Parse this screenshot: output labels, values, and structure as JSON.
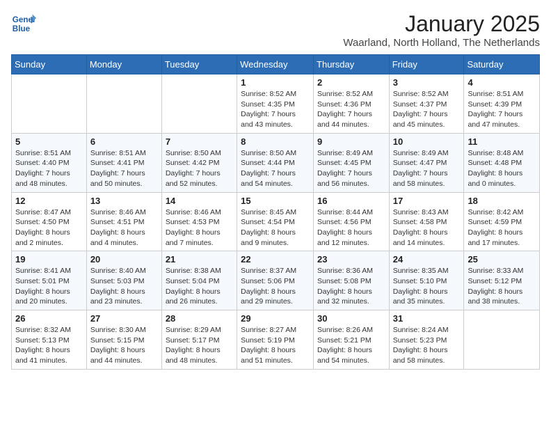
{
  "logo": {
    "line1": "General",
    "line2": "Blue"
  },
  "title": "January 2025",
  "subtitle": "Waarland, North Holland, The Netherlands",
  "weekdays": [
    "Sunday",
    "Monday",
    "Tuesday",
    "Wednesday",
    "Thursday",
    "Friday",
    "Saturday"
  ],
  "weeks": [
    [
      {
        "day": "",
        "info": ""
      },
      {
        "day": "",
        "info": ""
      },
      {
        "day": "",
        "info": ""
      },
      {
        "day": "1",
        "info": "Sunrise: 8:52 AM\nSunset: 4:35 PM\nDaylight: 7 hours\nand 43 minutes."
      },
      {
        "day": "2",
        "info": "Sunrise: 8:52 AM\nSunset: 4:36 PM\nDaylight: 7 hours\nand 44 minutes."
      },
      {
        "day": "3",
        "info": "Sunrise: 8:52 AM\nSunset: 4:37 PM\nDaylight: 7 hours\nand 45 minutes."
      },
      {
        "day": "4",
        "info": "Sunrise: 8:51 AM\nSunset: 4:39 PM\nDaylight: 7 hours\nand 47 minutes."
      }
    ],
    [
      {
        "day": "5",
        "info": "Sunrise: 8:51 AM\nSunset: 4:40 PM\nDaylight: 7 hours\nand 48 minutes."
      },
      {
        "day": "6",
        "info": "Sunrise: 8:51 AM\nSunset: 4:41 PM\nDaylight: 7 hours\nand 50 minutes."
      },
      {
        "day": "7",
        "info": "Sunrise: 8:50 AM\nSunset: 4:42 PM\nDaylight: 7 hours\nand 52 minutes."
      },
      {
        "day": "8",
        "info": "Sunrise: 8:50 AM\nSunset: 4:44 PM\nDaylight: 7 hours\nand 54 minutes."
      },
      {
        "day": "9",
        "info": "Sunrise: 8:49 AM\nSunset: 4:45 PM\nDaylight: 7 hours\nand 56 minutes."
      },
      {
        "day": "10",
        "info": "Sunrise: 8:49 AM\nSunset: 4:47 PM\nDaylight: 7 hours\nand 58 minutes."
      },
      {
        "day": "11",
        "info": "Sunrise: 8:48 AM\nSunset: 4:48 PM\nDaylight: 8 hours\nand 0 minutes."
      }
    ],
    [
      {
        "day": "12",
        "info": "Sunrise: 8:47 AM\nSunset: 4:50 PM\nDaylight: 8 hours\nand 2 minutes."
      },
      {
        "day": "13",
        "info": "Sunrise: 8:46 AM\nSunset: 4:51 PM\nDaylight: 8 hours\nand 4 minutes."
      },
      {
        "day": "14",
        "info": "Sunrise: 8:46 AM\nSunset: 4:53 PM\nDaylight: 8 hours\nand 7 minutes."
      },
      {
        "day": "15",
        "info": "Sunrise: 8:45 AM\nSunset: 4:54 PM\nDaylight: 8 hours\nand 9 minutes."
      },
      {
        "day": "16",
        "info": "Sunrise: 8:44 AM\nSunset: 4:56 PM\nDaylight: 8 hours\nand 12 minutes."
      },
      {
        "day": "17",
        "info": "Sunrise: 8:43 AM\nSunset: 4:58 PM\nDaylight: 8 hours\nand 14 minutes."
      },
      {
        "day": "18",
        "info": "Sunrise: 8:42 AM\nSunset: 4:59 PM\nDaylight: 8 hours\nand 17 minutes."
      }
    ],
    [
      {
        "day": "19",
        "info": "Sunrise: 8:41 AM\nSunset: 5:01 PM\nDaylight: 8 hours\nand 20 minutes."
      },
      {
        "day": "20",
        "info": "Sunrise: 8:40 AM\nSunset: 5:03 PM\nDaylight: 8 hours\nand 23 minutes."
      },
      {
        "day": "21",
        "info": "Sunrise: 8:38 AM\nSunset: 5:04 PM\nDaylight: 8 hours\nand 26 minutes."
      },
      {
        "day": "22",
        "info": "Sunrise: 8:37 AM\nSunset: 5:06 PM\nDaylight: 8 hours\nand 29 minutes."
      },
      {
        "day": "23",
        "info": "Sunrise: 8:36 AM\nSunset: 5:08 PM\nDaylight: 8 hours\nand 32 minutes."
      },
      {
        "day": "24",
        "info": "Sunrise: 8:35 AM\nSunset: 5:10 PM\nDaylight: 8 hours\nand 35 minutes."
      },
      {
        "day": "25",
        "info": "Sunrise: 8:33 AM\nSunset: 5:12 PM\nDaylight: 8 hours\nand 38 minutes."
      }
    ],
    [
      {
        "day": "26",
        "info": "Sunrise: 8:32 AM\nSunset: 5:13 PM\nDaylight: 8 hours\nand 41 minutes."
      },
      {
        "day": "27",
        "info": "Sunrise: 8:30 AM\nSunset: 5:15 PM\nDaylight: 8 hours\nand 44 minutes."
      },
      {
        "day": "28",
        "info": "Sunrise: 8:29 AM\nSunset: 5:17 PM\nDaylight: 8 hours\nand 48 minutes."
      },
      {
        "day": "29",
        "info": "Sunrise: 8:27 AM\nSunset: 5:19 PM\nDaylight: 8 hours\nand 51 minutes."
      },
      {
        "day": "30",
        "info": "Sunrise: 8:26 AM\nSunset: 5:21 PM\nDaylight: 8 hours\nand 54 minutes."
      },
      {
        "day": "31",
        "info": "Sunrise: 8:24 AM\nSunset: 5:23 PM\nDaylight: 8 hours\nand 58 minutes."
      },
      {
        "day": "",
        "info": ""
      }
    ]
  ]
}
